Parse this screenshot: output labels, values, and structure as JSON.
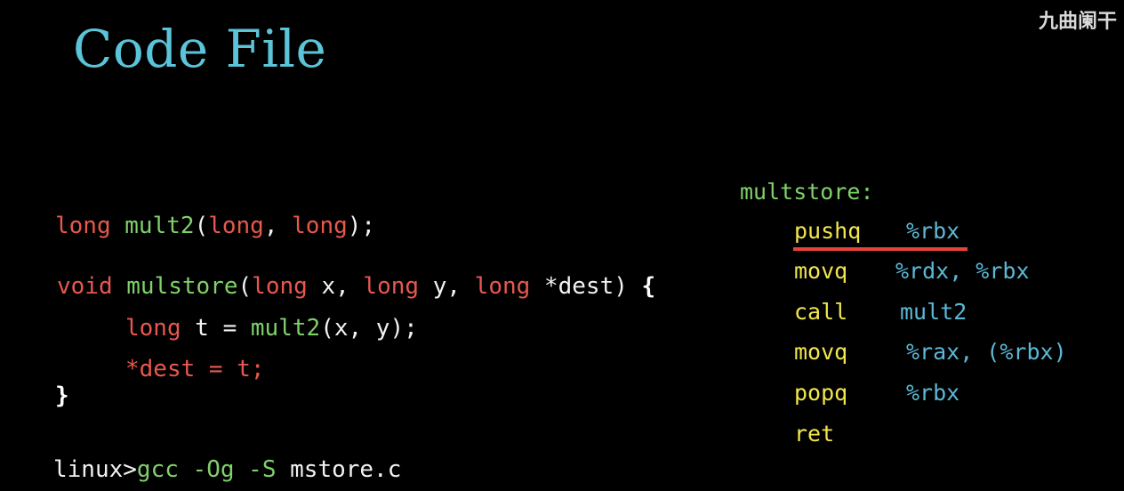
{
  "title": "Code File",
  "watermark": "九曲阑干",
  "c_code": {
    "proto": {
      "ret_type": "long",
      "func": "mult2",
      "open": "(",
      "arg1": "long",
      "comma": ", ",
      "arg2": "long",
      "close": ");"
    },
    "def": {
      "ret_type": "void",
      "func": "mulstore",
      "open": "(",
      "t1": "long",
      "p1": " x, ",
      "t2": "long",
      "p2": " y, ",
      "t3": "long",
      "p3": " *dest) ",
      "brace": "{"
    },
    "line1": {
      "type": "long",
      "mid": " t = ",
      "func": "mult2",
      "args": "(x, y);"
    },
    "line2": "*dest = t;",
    "close_brace": "}"
  },
  "command": {
    "prompt": "linux>",
    "cmd": "gcc",
    "flag1": "-Og",
    "flag2": "-S",
    "file": "mstore.c"
  },
  "assembly": {
    "label": "multstore:",
    "instructions": [
      {
        "op": "pushq",
        "operands": "%rbx"
      },
      {
        "op": "movq",
        "operands": "%rdx, %rbx"
      },
      {
        "op": "call",
        "operands": "mult2"
      },
      {
        "op": "movq",
        "operands": "%rax, (%rbx)"
      },
      {
        "op": "popq",
        "operands": "%rbx"
      },
      {
        "op": "ret",
        "operands": ""
      }
    ]
  },
  "colors": {
    "title": "#5bc4d8",
    "keyword": "#e8584f",
    "function": "#7fd16a",
    "instruction": "#f2e64d",
    "register": "#5bb8d6",
    "highlight_underline": "#e8433a"
  }
}
